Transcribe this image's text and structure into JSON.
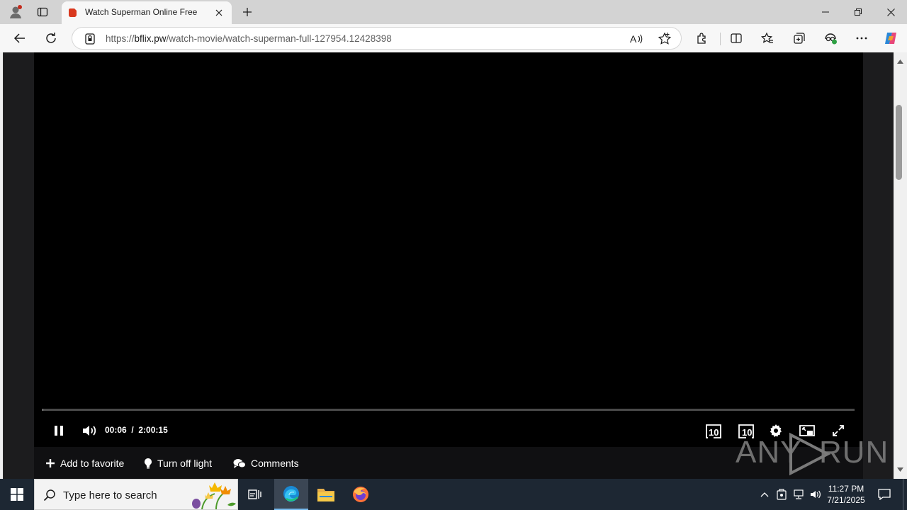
{
  "browser": {
    "tab_title": "Watch Superman Online Free",
    "url_prefix": "https://",
    "url_host": "bflix.pw",
    "url_path": "/watch-movie/watch-superman-full-127954.12428398"
  },
  "player": {
    "current_time": "00:06",
    "separator": "/",
    "duration": "2:00:15",
    "progress_fraction": 0.0008,
    "rewind_label": "10",
    "forward_label": "10"
  },
  "actions": {
    "favorite": "Add to favorite",
    "light": "Turn off light",
    "comments": "Comments"
  },
  "watermark": {
    "text_left": "ANY",
    "text_right": "RUN"
  },
  "taskbar": {
    "search_placeholder": "Type here to search",
    "time": "11:27 PM",
    "date": "7/21/2025"
  },
  "colors": {
    "titlebar": "#d3d3d3",
    "toolbar": "#f7f7f7",
    "page_bg": "#1c1c1e",
    "player_bg": "#000000",
    "taskbar": "#1d2733",
    "favicon": "#d9381e"
  }
}
